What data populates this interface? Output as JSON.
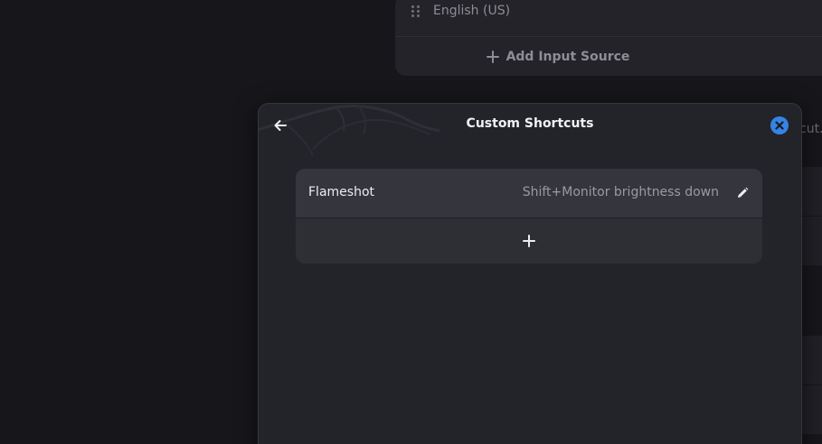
{
  "background": {
    "input_source": "English (US)",
    "add_input_source_label": "Add Input Source",
    "peek_text": "cut."
  },
  "dialog": {
    "title": "Custom Shortcuts",
    "back_icon": "arrow-left-icon",
    "close_icon": "close-circle-icon",
    "shortcuts": [
      {
        "name": "Flameshot",
        "accelerator": "Shift+Monitor brightness down",
        "edit_icon": "pencil-icon"
      }
    ],
    "add_icon": "plus-icon"
  },
  "colors": {
    "accent": "#3584e4",
    "dialog_bg": "#23232a",
    "row_bg": "#35353d"
  }
}
